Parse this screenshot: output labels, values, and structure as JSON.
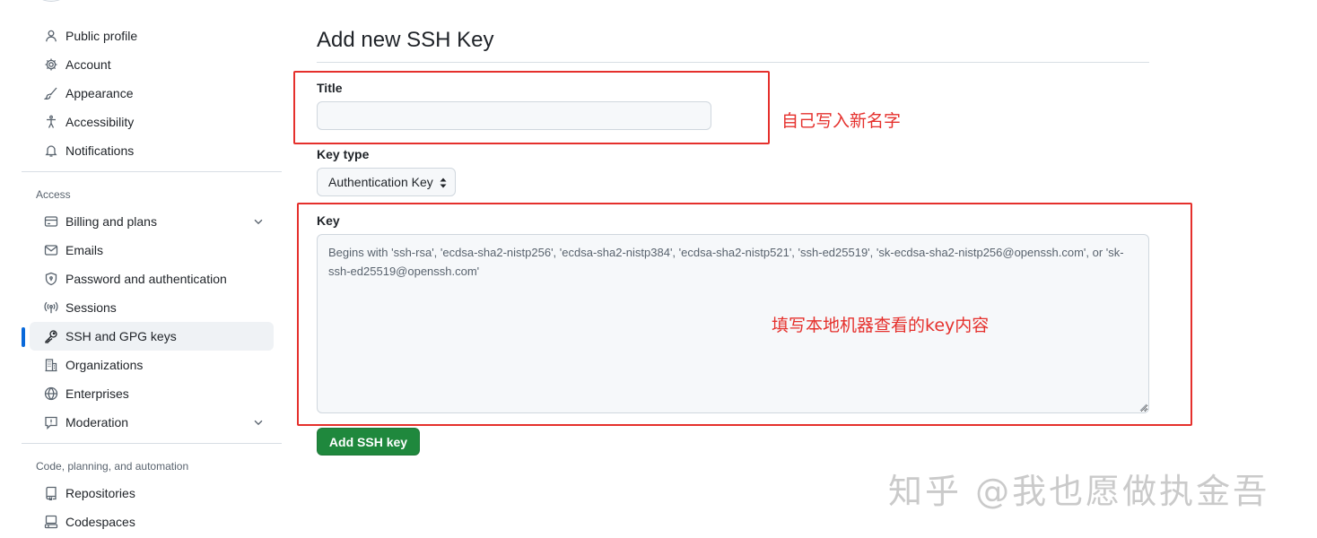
{
  "sidebar": {
    "items_top": [
      {
        "label": "Public profile",
        "icon": "person-icon"
      },
      {
        "label": "Account",
        "icon": "gear-icon"
      },
      {
        "label": "Appearance",
        "icon": "paintbrush-icon"
      },
      {
        "label": "Accessibility",
        "icon": "accessibility-icon"
      },
      {
        "label": "Notifications",
        "icon": "bell-icon"
      }
    ],
    "access_heading": "Access",
    "access_items": [
      {
        "label": "Billing and plans",
        "icon": "credit-card-icon",
        "expandable": true
      },
      {
        "label": "Emails",
        "icon": "mail-icon"
      },
      {
        "label": "Password and authentication",
        "icon": "shield-lock-icon"
      },
      {
        "label": "Sessions",
        "icon": "broadcast-icon"
      },
      {
        "label": "SSH and GPG keys",
        "icon": "key-icon",
        "active": true
      },
      {
        "label": "Organizations",
        "icon": "organization-icon"
      },
      {
        "label": "Enterprises",
        "icon": "globe-icon"
      },
      {
        "label": "Moderation",
        "icon": "report-icon",
        "expandable": true
      }
    ],
    "code_heading": "Code, planning, and automation",
    "code_items": [
      {
        "label": "Repositories",
        "icon": "repo-icon"
      },
      {
        "label": "Codespaces",
        "icon": "codespaces-icon"
      }
    ]
  },
  "main": {
    "title": "Add new SSH Key",
    "title_field": {
      "label": "Title",
      "value": ""
    },
    "key_type": {
      "label": "Key type",
      "selected": "Authentication Key"
    },
    "key_field": {
      "label": "Key",
      "placeholder": "Begins with 'ssh-rsa', 'ecdsa-sha2-nistp256', 'ecdsa-sha2-nistp384', 'ecdsa-sha2-nistp521', 'ssh-ed25519', 'sk-ecdsa-sha2-nistp256@openssh.com', or 'sk-ssh-ed25519@openssh.com'"
    },
    "submit_label": "Add SSH key"
  },
  "annotations": {
    "title_note": "自己写入新名字",
    "key_note": "填写本地机器查看的key内容",
    "color": "#e5302c"
  },
  "watermark": "知乎 @我也愿做执金吾",
  "colors": {
    "primary_button": "#1f883d",
    "active_indicator": "#0969da",
    "text": "#1f2328",
    "muted": "#59636e"
  }
}
